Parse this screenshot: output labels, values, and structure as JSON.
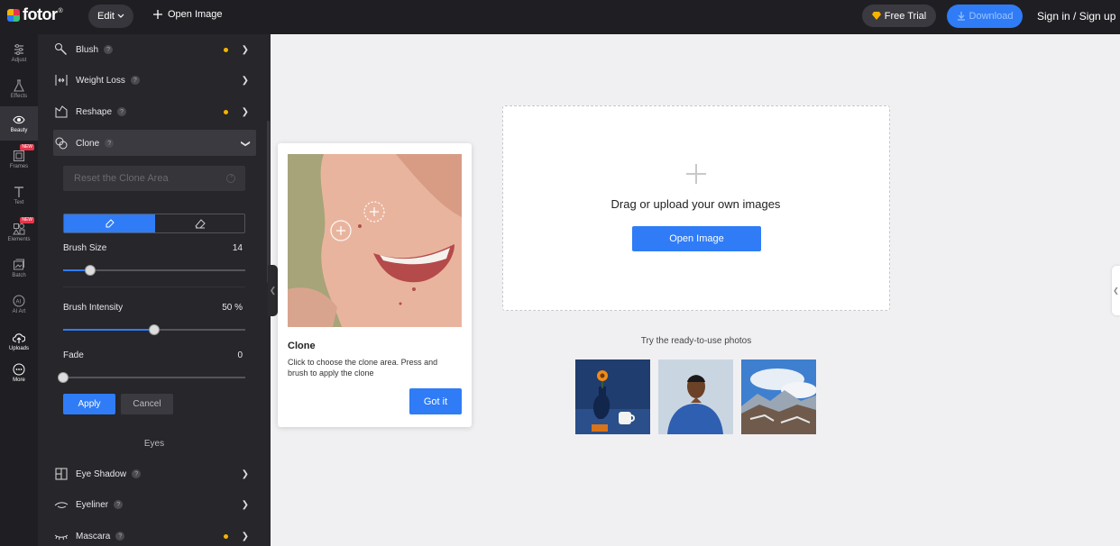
{
  "app": {
    "logo_text": "fotor",
    "logo_mark": "®",
    "edit_label": "Edit",
    "open_image_label": "Open Image",
    "free_trial_label": "Free Trial",
    "download_label": "Download",
    "sign_label": "Sign in / Sign up",
    "accent_color": "#2f7cf6"
  },
  "rail": {
    "items": [
      {
        "label": "Adjust",
        "icon": "sliders-icon"
      },
      {
        "label": "Effects",
        "icon": "flask-icon"
      },
      {
        "label": "Beauty",
        "icon": "eye-icon"
      },
      {
        "label": "Frames",
        "icon": "frame-icon",
        "badge": "NEW"
      },
      {
        "label": "Text",
        "icon": "text-icon"
      },
      {
        "label": "Elements",
        "icon": "elements-icon",
        "badge": "NEW"
      },
      {
        "label": "Batch",
        "icon": "batch-icon"
      },
      {
        "label": "AI Art",
        "icon": "ai-icon"
      },
      {
        "label": "Uploads",
        "icon": "cloud-upload-icon"
      },
      {
        "label": "More",
        "icon": "more-icon"
      }
    ]
  },
  "panel": {
    "tools": [
      {
        "label": "Blush",
        "dot": true
      },
      {
        "label": "Weight Loss",
        "dot": false
      },
      {
        "label": "Reshape",
        "dot": true
      },
      {
        "label": "Clone",
        "dot": false
      }
    ],
    "reset_label": "Reset the Clone Area",
    "brush_size": {
      "label": "Brush Size",
      "value": "14",
      "level": 0.15
    },
    "brush_intensity": {
      "label": "Brush Intensity",
      "value": "50 %",
      "level": 0.5
    },
    "fade": {
      "label": "Fade",
      "value": "0",
      "level": 0.0
    },
    "apply_label": "Apply",
    "cancel_label": "Cancel",
    "section_eyes": "Eyes",
    "eye_tools": [
      {
        "label": "Eye Shadow",
        "dot": false
      },
      {
        "label": "Eyeliner",
        "dot": false
      },
      {
        "label": "Mascara",
        "dot": true
      }
    ]
  },
  "tooltip": {
    "title": "Clone",
    "text": "Click to choose the clone area. Press and brush to apply the clone",
    "button": "Got it"
  },
  "canvas": {
    "drop_text": "Drag or upload your own images",
    "open_button": "Open Image",
    "try_text": "Try the ready-to-use photos"
  }
}
